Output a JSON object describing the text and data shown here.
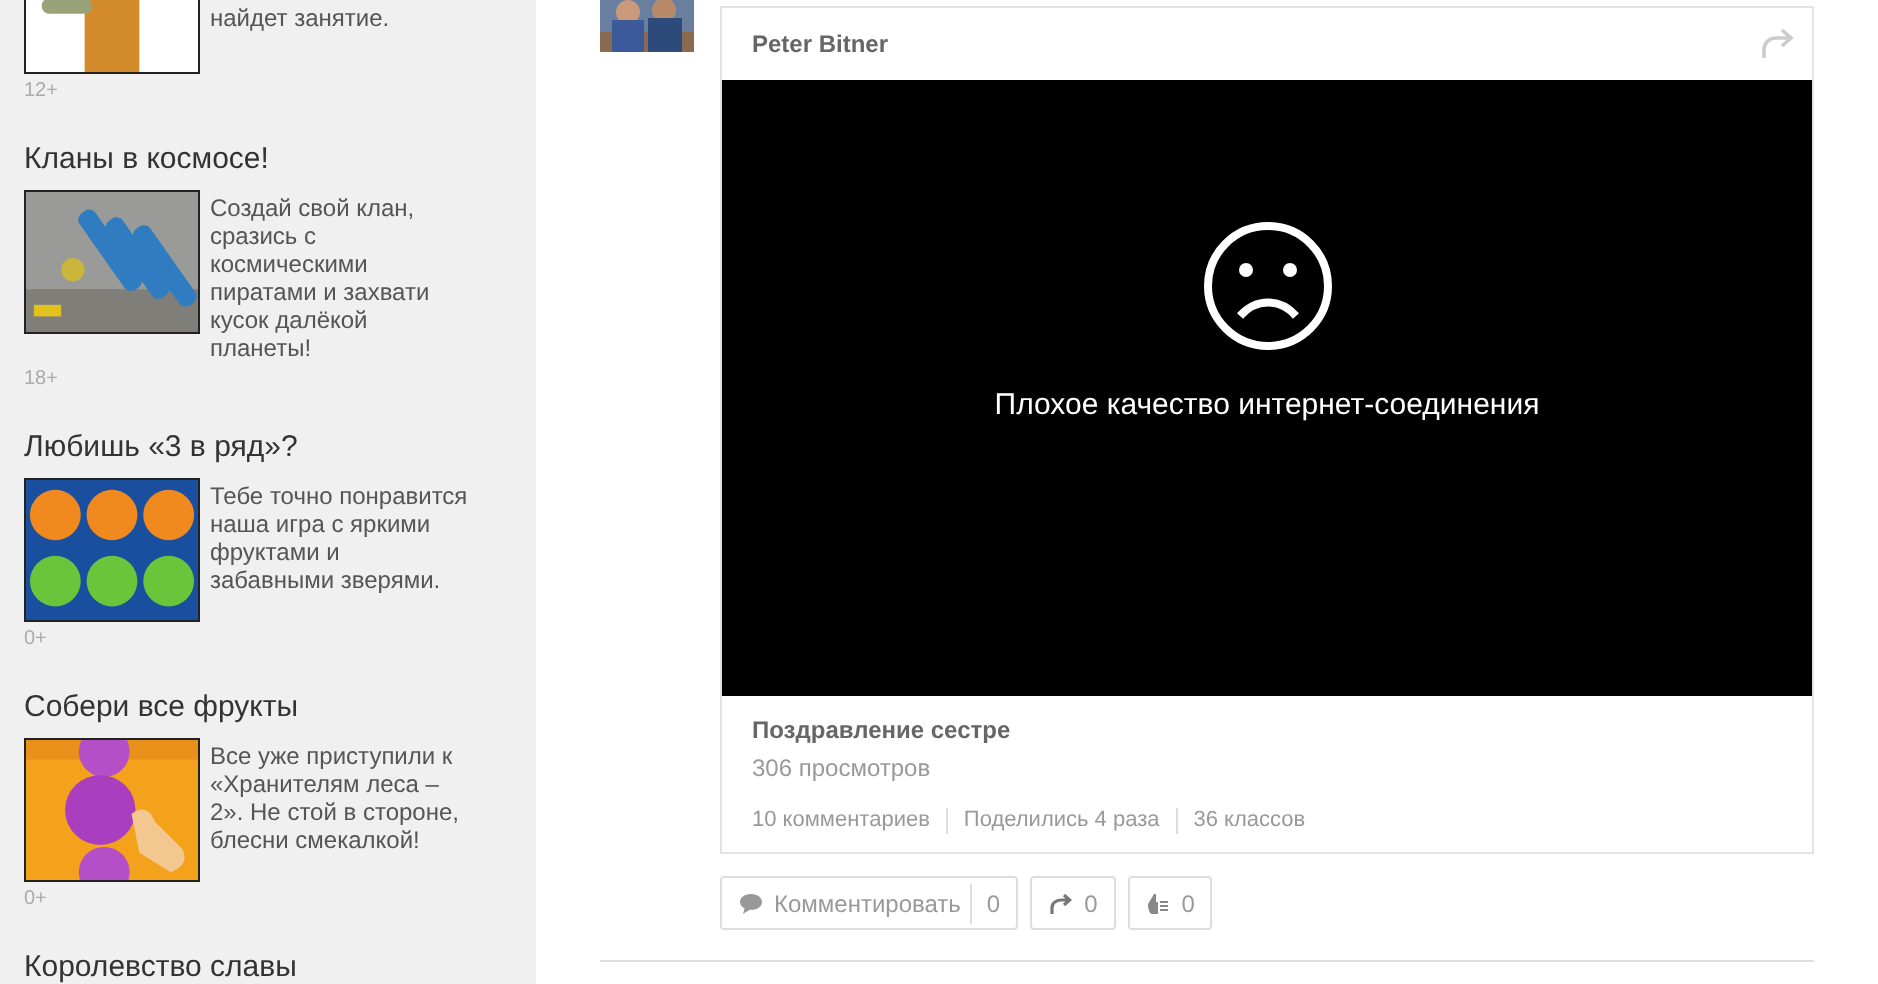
{
  "sidebar": {
    "games": [
      {
        "description": "найдет занятие.",
        "age": "12+"
      },
      {
        "title": "Кланы в космосе!",
        "description": "Создай свой клан, сразись с космическими пиратами и захвати кусок далёкой планеты!",
        "age": "18+"
      },
      {
        "title": "Любишь «3 в ряд»?",
        "description": "Тебе точно понравится наша игра с яркими фруктами и забавными зверями.",
        "age": "0+"
      },
      {
        "title": "Собери все фрукты",
        "description": "Все уже приступили к «Хранителям леса – 2». Не стой в стороне, блесни смекалкой!",
        "age": "0+"
      },
      {
        "title": "Королевство славы"
      }
    ]
  },
  "post": {
    "author": "Peter Bitner",
    "video": {
      "message": "Плохое качество интернет-соединения"
    },
    "title": "Поздравление сестре",
    "views": "306 просмотров",
    "stats": [
      "10 комментариев",
      "Поделились 4 раза",
      "36 классов"
    ],
    "actions": [
      {
        "kind": "comment",
        "label": "Комментировать",
        "count": "0"
      },
      {
        "kind": "share",
        "count": "0"
      },
      {
        "kind": "like",
        "count": "0"
      }
    ]
  }
}
